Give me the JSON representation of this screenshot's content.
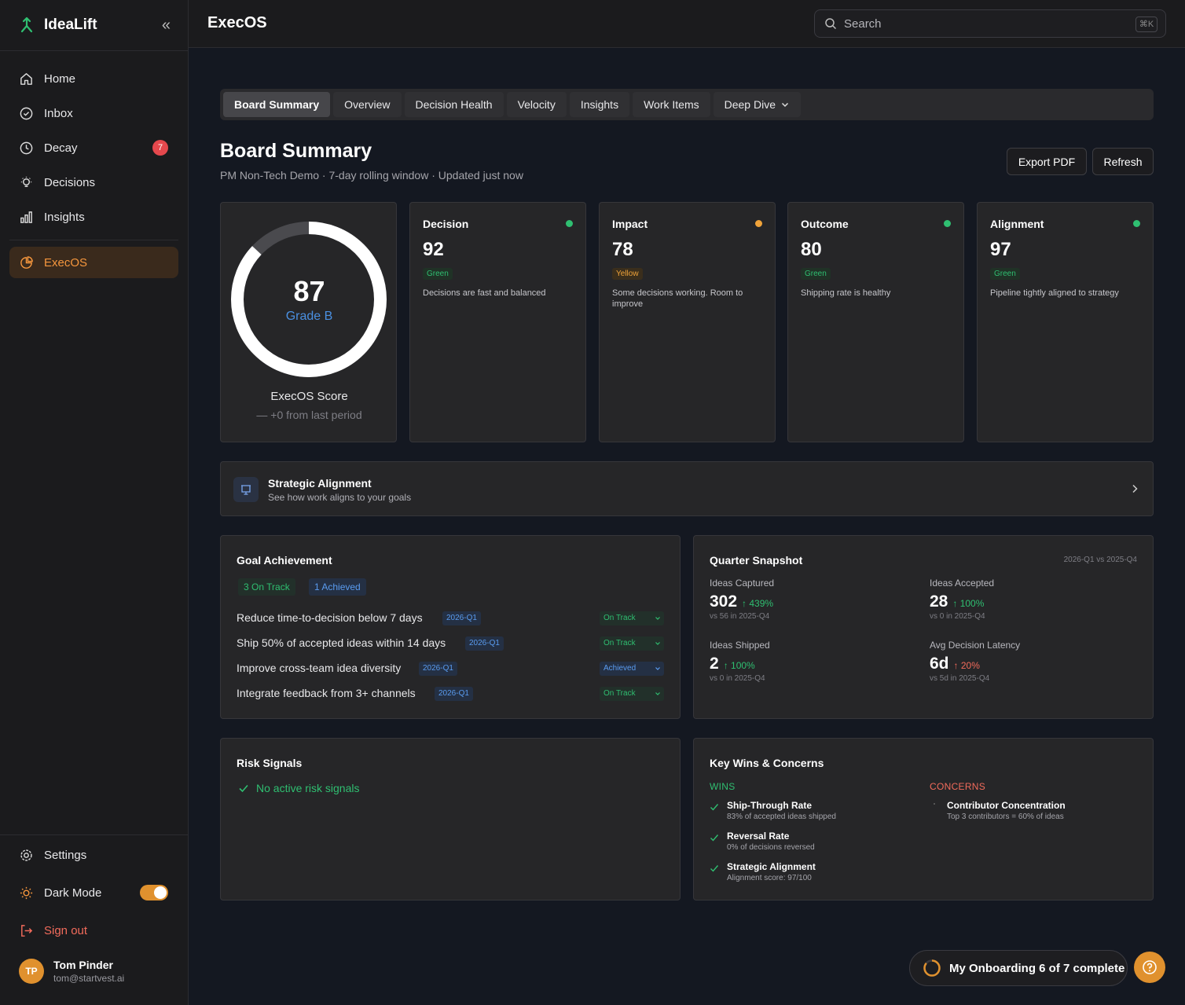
{
  "brand": {
    "name": "IdeaLift",
    "collapse_icon": "double-chevron-left-icon"
  },
  "nav": {
    "items": [
      {
        "label": "Home",
        "icon": "home-icon"
      },
      {
        "label": "Inbox",
        "icon": "check-circle-icon"
      },
      {
        "label": "Decay",
        "icon": "clock-icon",
        "badge": "7"
      },
      {
        "label": "Decisions",
        "icon": "lightbulb-icon"
      },
      {
        "label": "Insights",
        "icon": "bar-chart-icon"
      }
    ],
    "active": {
      "label": "ExecOS",
      "icon": "pie-chart-icon"
    }
  },
  "sidebar_bottom": {
    "settings": "Settings",
    "dark_mode": "Dark Mode",
    "dark_mode_on": true,
    "sign_out": "Sign out",
    "user": {
      "initials": "TP",
      "name": "Tom Pinder",
      "email": "tom@startvest.ai"
    }
  },
  "topbar": {
    "title": "ExecOS",
    "search_placeholder": "Search",
    "shortcut": "⌘K"
  },
  "tabs": [
    "Board Summary",
    "Overview",
    "Decision Health",
    "Velocity",
    "Insights",
    "Work Items",
    "Deep Dive"
  ],
  "active_tab": "Board Summary",
  "page": {
    "title": "Board Summary",
    "subtitle": "PM Non-Tech Demo · 7-day rolling window · Updated just now",
    "export_label": "Export PDF",
    "refresh_label": "Refresh"
  },
  "score": {
    "value": "87",
    "fraction": 0.87,
    "grade": "Grade B",
    "label": "ExecOS Score",
    "change": "— +0 from last period"
  },
  "metrics": [
    {
      "name": "Decision",
      "value": "92",
      "status": "Green",
      "color": "#2fbf71",
      "desc": "Decisions are fast and balanced"
    },
    {
      "name": "Impact",
      "value": "78",
      "status": "Yellow",
      "color": "#f0a33a",
      "desc": "Some decisions working. Room to improve"
    },
    {
      "name": "Outcome",
      "value": "80",
      "status": "Green",
      "color": "#2fbf71",
      "desc": "Shipping rate is healthy"
    },
    {
      "name": "Alignment",
      "value": "97",
      "status": "Green",
      "color": "#2fbf71",
      "desc": "Pipeline tightly aligned to strategy"
    }
  ],
  "strategic": {
    "title": "Strategic Alignment",
    "subtitle": "See how work aligns to your goals"
  },
  "goals": {
    "title": "Goal Achievement",
    "on_track_chip": "3 On Track",
    "achieved_chip": "1 Achieved",
    "rows": [
      {
        "text": "Reduce time-to-decision below 7 days",
        "quarter": "2026-Q1",
        "status": "On Track"
      },
      {
        "text": "Ship 50% of accepted ideas within 14 days",
        "quarter": "2026-Q1",
        "status": "On Track"
      },
      {
        "text": "Improve cross-team idea diversity",
        "quarter": "2026-Q1",
        "status": "Achieved"
      },
      {
        "text": "Integrate feedback from 3+ channels",
        "quarter": "2026-Q1",
        "status": "On Track"
      }
    ]
  },
  "snapshot": {
    "title": "Quarter Snapshot",
    "compare": "2026-Q1 vs 2025-Q4",
    "cells": [
      {
        "label": "Ideas Captured",
        "value": "302",
        "delta": "↑ 439%",
        "dir": "up",
        "prev": "vs 56 in 2025-Q4"
      },
      {
        "label": "Ideas Accepted",
        "value": "28",
        "delta": "↑ 100%",
        "dir": "up",
        "prev": "vs 0 in 2025-Q4"
      },
      {
        "label": "Ideas Shipped",
        "value": "2",
        "delta": "↑ 100%",
        "dir": "up",
        "prev": "vs 0 in 2025-Q4"
      },
      {
        "label": "Avg Decision Latency",
        "value": "6d",
        "delta": "↑ 20%",
        "dir": "down",
        "prev": "vs 5d in 2025-Q4"
      }
    ]
  },
  "risk": {
    "title": "Risk Signals",
    "message": "No active risk signals"
  },
  "wins_concerns": {
    "title": "Key Wins & Concerns",
    "wins_label": "WINS",
    "concerns_label": "CONCERNS",
    "wins": [
      {
        "title": "Ship-Through Rate",
        "sub": "83% of accepted ideas shipped"
      },
      {
        "title": "Reversal Rate",
        "sub": "0% of decisions reversed"
      },
      {
        "title": "Strategic Alignment",
        "sub": "Alignment score: 97/100"
      }
    ],
    "concerns": [
      {
        "title": "Contributor Concentration",
        "sub": "Top 3 contributors = 60% of ideas"
      }
    ]
  },
  "onboarding": {
    "label": "My Onboarding 6 of 7 complete"
  }
}
